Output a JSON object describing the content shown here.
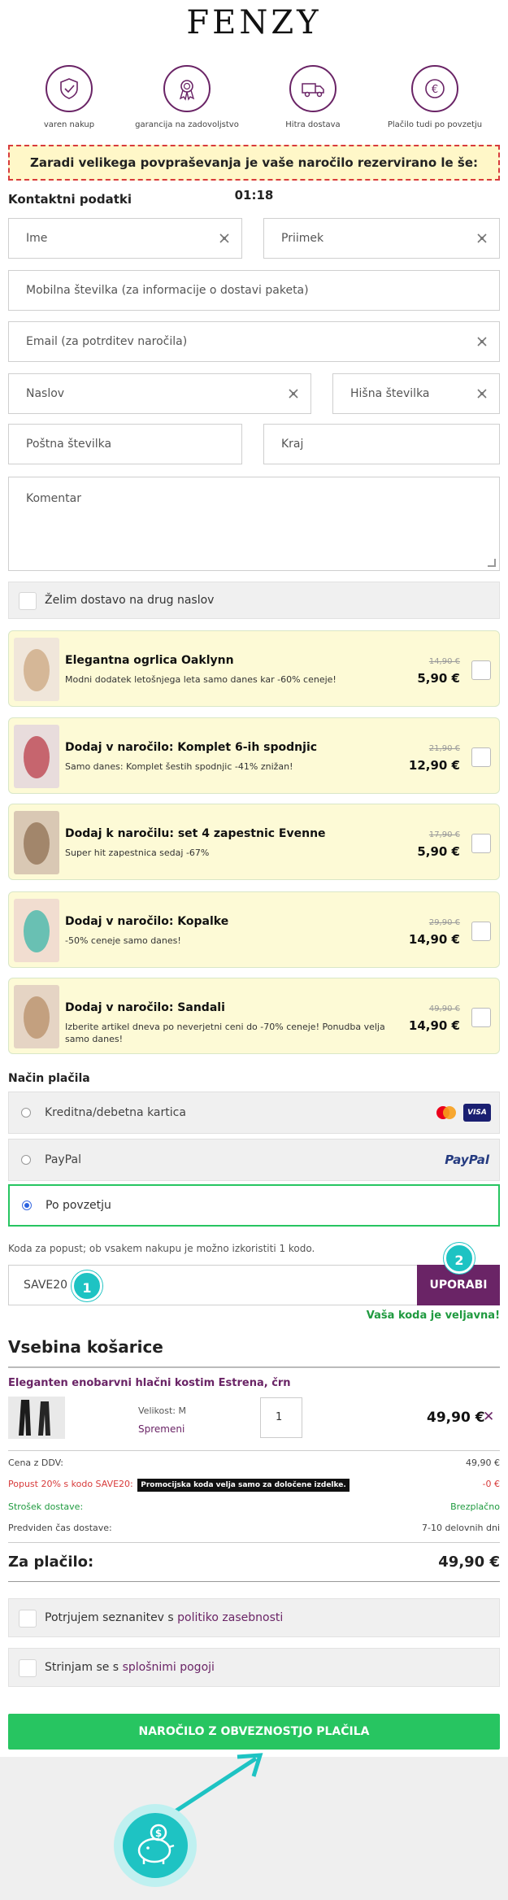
{
  "brand": "FENZY",
  "badges": [
    {
      "label": "varen nakup",
      "icon": "shield-check-icon"
    },
    {
      "label": "garancija na zadovoljstvo",
      "icon": "award-ribbon-icon"
    },
    {
      "label": "Hitra dostava",
      "icon": "delivery-truck-icon"
    },
    {
      "label": "Plačilo tudi po povzetju",
      "icon": "euro-coin-icon"
    }
  ],
  "timer": {
    "text": "Zaradi velikega povpraševanja je vaše naročilo rezervirano le še: 01:18"
  },
  "contact": {
    "heading": "Kontaktni podatki",
    "first_name": "Ime",
    "last_name": "Priimek",
    "phone": "Mobilna številka (za informacije o dostavi paketa)",
    "email": "Email (za potrditev naročila)",
    "address": "Naslov",
    "house_number": "Hišna številka",
    "postal_code": "Poštna številka",
    "city": "Kraj",
    "comment": "Komentar",
    "other_address": "Želim dostavo na drug naslov"
  },
  "offers": [
    {
      "title": "Elegantna ogrlica Oaklynn",
      "desc": "Modni dodatek letošnjega leta samo danes kar -60% ceneje!",
      "old": "14,90 €",
      "new": "5,90 €",
      "colors": [
        "#c9a27a",
        "#f0e6da"
      ]
    },
    {
      "title": "Dodaj v naročilo: Komplet 6-ih spodnjic",
      "desc": "Samo danes: Komplet šestih spodnjic -41% znižan!",
      "old": "21,90 €",
      "new": "12,90 €",
      "colors": [
        "#b8323f",
        "#e8dcdc"
      ]
    },
    {
      "title": "Dodaj k naročilu: set 4 zapestnic Evenne",
      "desc": "Super hit zapestnica sedaj -67%",
      "old": "17,90 €",
      "new": "5,90 €",
      "colors": [
        "#8a6a4c",
        "#d9c8b4"
      ]
    },
    {
      "title": "Dodaj v naročilo: Kopalke",
      "desc": "-50% ceneje samo danes!",
      "old": "29,90 €",
      "new": "14,90 €",
      "colors": [
        "#2fb3a6",
        "#f1ddd0"
      ]
    },
    {
      "title": "Dodaj v naročilo: Sandali",
      "desc": "Izberite artikel dneva po neverjetni ceni do -70% ceneje! Ponudba velja samo danes!",
      "old": "49,90 €",
      "new": "14,90 €",
      "colors": [
        "#b58a63",
        "#e5d4c4"
      ]
    }
  ],
  "payment": {
    "heading": "Način plačila",
    "options": [
      "Kreditna/debetna kartica",
      "PayPal",
      "Po povzetju"
    ],
    "paypal_logo": "PayPal",
    "visa": "VISA"
  },
  "coupon": {
    "hint": "Koda za popust; ob vsakem nakupu je možno izkoristiti 1 kodo.",
    "value": "SAVE20",
    "apply": "UPORABI",
    "valid": "Vaša koda je veljavna!",
    "step1": "1",
    "step2": "2"
  },
  "cart": {
    "heading": "Vsebina košarice",
    "product": "Eleganten enobarvni hlačni kostim Estrena, črn",
    "size": "Velikost: M",
    "change": "Spremeni",
    "qty": "1",
    "price": "49,90 €",
    "remove": "✕"
  },
  "summary": {
    "rows": [
      {
        "label": "Cena z DDV:",
        "value": "49,90 €"
      },
      {
        "label": "Popust 20% s kodo SAVE20:",
        "value": "-0 €",
        "tooltip": "Promocijska koda velja samo za določene izdelke."
      },
      {
        "label": "Strošek dostave:",
        "value": "Brezplačno"
      },
      {
        "label": "Predviden čas dostave:",
        "value": "7-10 delovnih dni"
      }
    ],
    "total_label": "Za plačilo:",
    "total_value": "49,90 €"
  },
  "consents": {
    "privacy_pre": "Potrjujem seznanitev s ",
    "privacy_link": "politiko zasebnosti",
    "terms_pre": "Strinjam se s ",
    "terms_link": "splošnimi pogoji"
  },
  "submit": "NAROČILO Z OBVEZNOSTJO PLAČILA",
  "colors": {
    "accent": "#6a2466",
    "green": "#27c561",
    "teal": "#1ec3c3",
    "yellow": "#fdfad6",
    "red": "#d83b3b"
  }
}
